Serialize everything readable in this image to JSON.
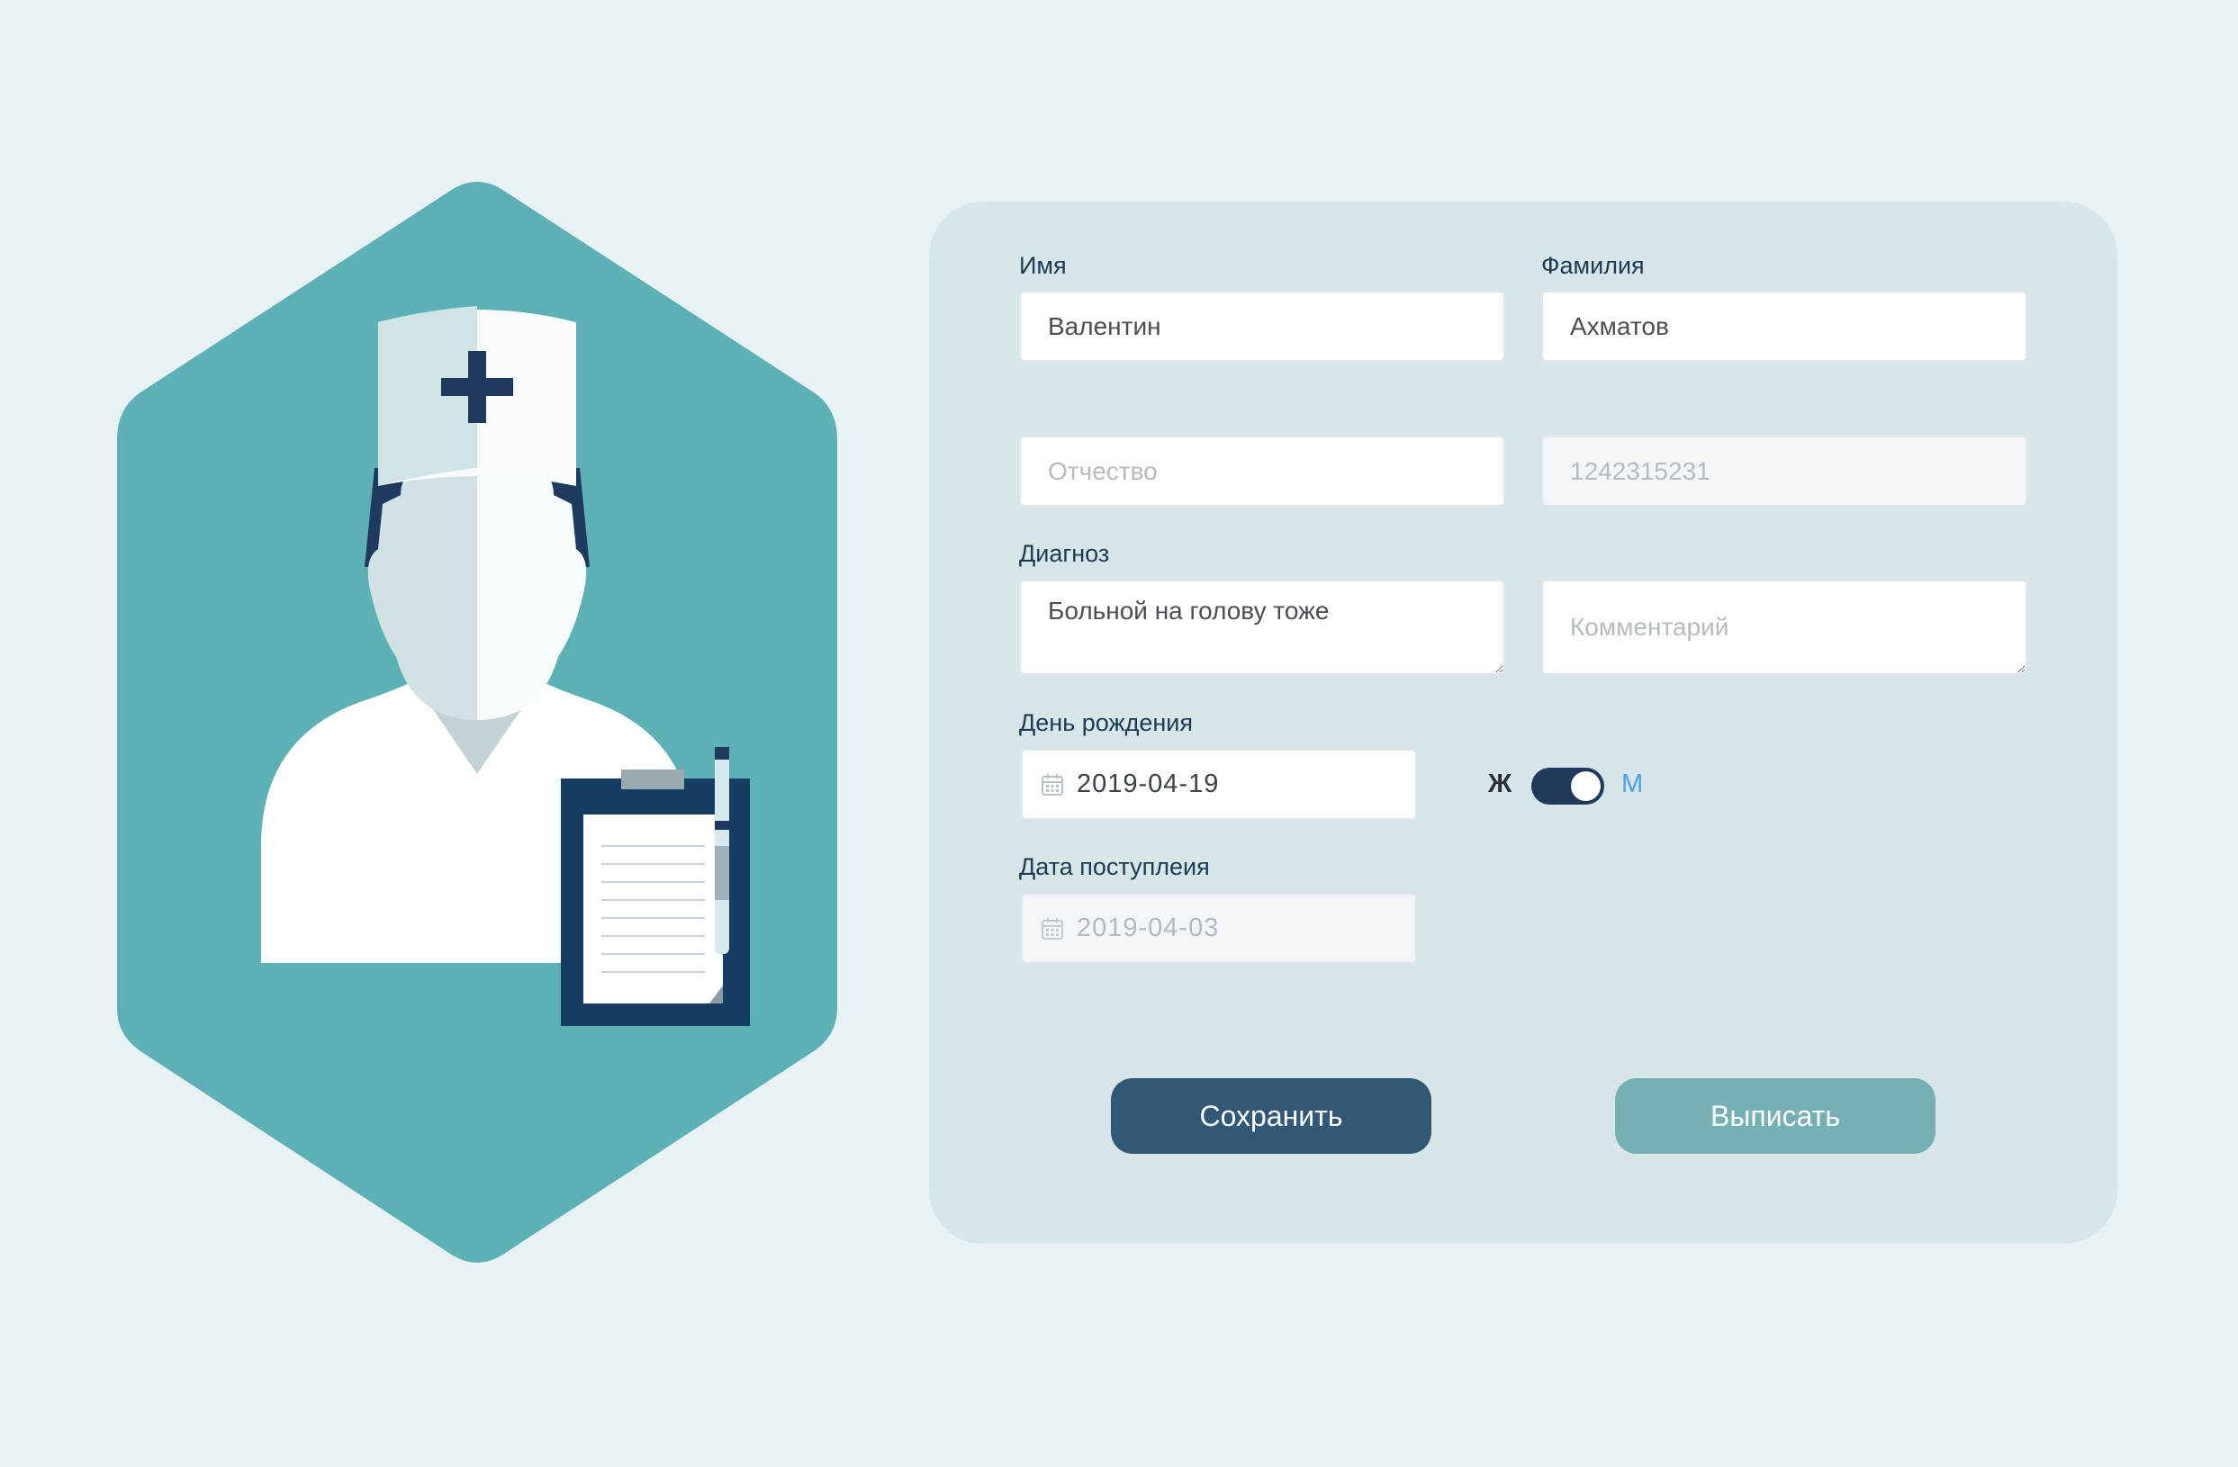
{
  "form": {
    "first_name": {
      "label": "Имя",
      "value": "Валентин"
    },
    "last_name": {
      "label": "Фамилия",
      "value": "Ахматов"
    },
    "patronymic": {
      "placeholder": "Отчество"
    },
    "id_number": {
      "placeholder": "1242315231"
    },
    "diagnosis": {
      "label": "Диагноз",
      "value": "Больной на голову тоже"
    },
    "comment": {
      "placeholder": "Комментарий"
    },
    "birthday": {
      "label": "День рождения",
      "value": "2019-04-19",
      "icon": "calendar-icon"
    },
    "gender": {
      "female_label": "Ж",
      "male_label": "М",
      "selected": "М"
    },
    "admission_date": {
      "label": "Дата поступлеия",
      "value": "2019-04-03",
      "icon": "calendar-icon"
    },
    "buttons": {
      "save": "Сохранить",
      "discharge": "Выписать"
    }
  },
  "colors": {
    "background": "#e8f1f3",
    "card": "#d6e6e9",
    "hexagon": "#5db1b5",
    "navy": "#203a5c",
    "save_button": "#335875",
    "discharge_button": "#76b0b4",
    "male_accent": "#4aa0ea"
  },
  "illustration": {
    "icon": "doctor-icon"
  }
}
